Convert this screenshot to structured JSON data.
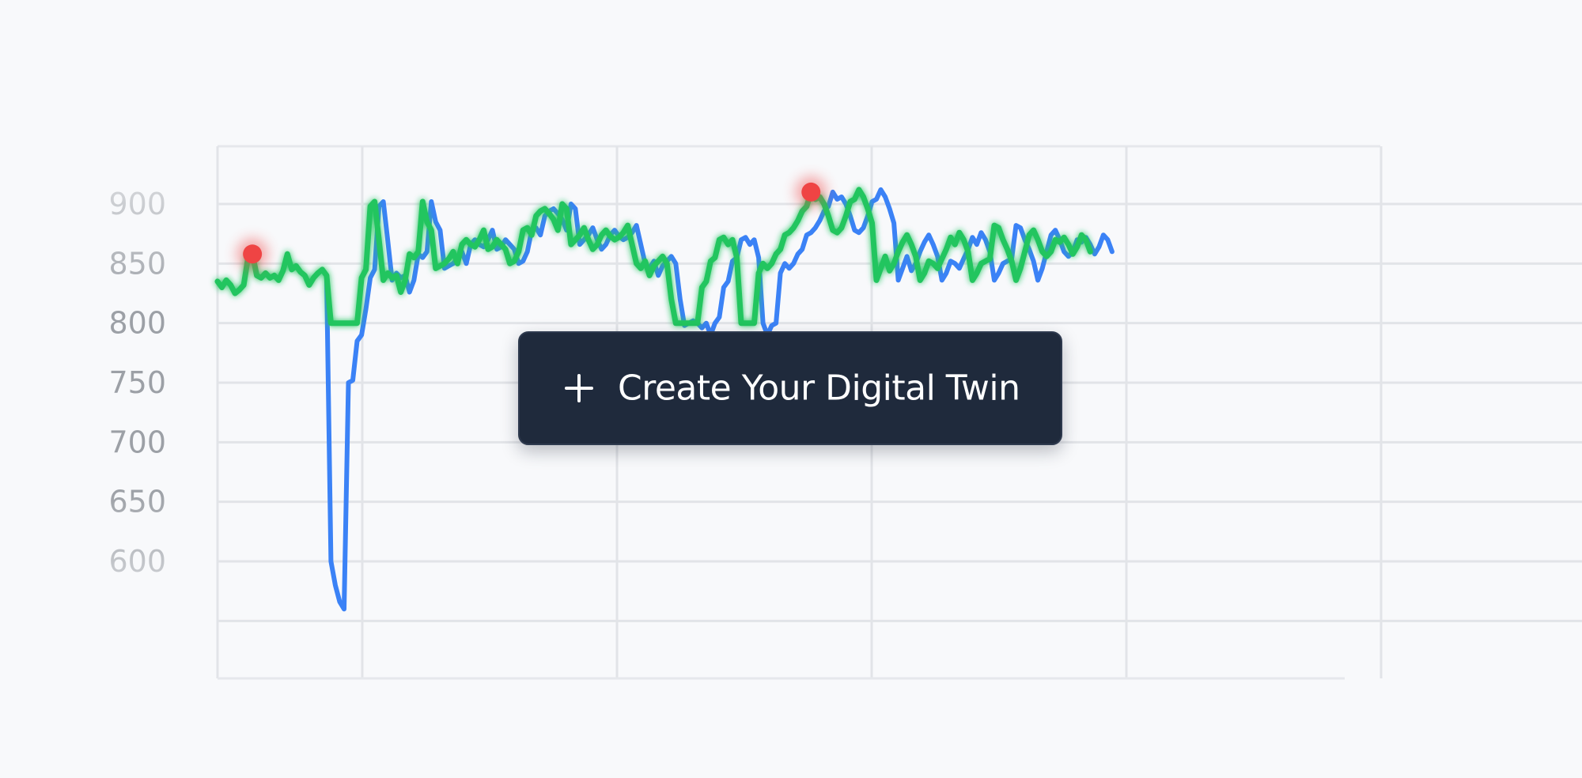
{
  "chart_data": {
    "type": "line",
    "y_ticks": [
      "900",
      "850",
      "800",
      "750",
      "700",
      "650",
      "600"
    ],
    "ylim": [
      550,
      950
    ],
    "grid": true,
    "x": [
      0,
      1,
      2,
      3,
      4,
      5,
      6,
      7,
      8,
      9,
      10,
      11,
      12,
      13,
      14,
      15,
      16,
      17,
      18,
      19,
      20,
      21,
      22,
      23,
      24,
      25,
      26,
      27,
      28,
      29,
      30,
      31,
      32,
      33,
      34,
      35,
      36,
      37,
      38,
      39,
      40,
      41,
      42,
      43,
      44,
      45,
      46,
      47,
      48,
      49,
      50,
      51,
      52,
      53,
      54,
      55,
      56,
      57,
      58,
      59,
      60,
      61,
      62,
      63,
      64,
      65,
      66,
      67,
      68,
      69,
      70,
      71,
      72,
      73,
      74,
      75,
      76,
      77,
      78,
      79,
      80,
      81,
      82,
      83,
      84,
      85,
      86,
      87,
      88,
      89,
      90,
      91,
      92,
      93,
      94,
      95,
      96,
      97,
      98,
      99,
      100,
      101,
      102,
      103,
      104,
      105,
      106,
      107,
      108,
      109,
      110,
      111,
      112,
      113,
      114,
      115,
      116,
      117,
      118,
      119,
      120,
      121,
      122,
      123,
      124,
      125,
      126,
      127,
      128,
      129,
      130,
      131,
      132,
      133,
      134,
      135,
      136,
      137,
      138,
      139,
      140,
      141,
      142,
      143,
      144,
      145,
      146,
      147,
      148,
      149,
      150,
      151,
      152,
      153,
      154,
      155,
      156,
      157,
      158,
      159,
      160,
      161,
      162,
      163,
      164,
      165,
      166,
      167,
      168,
      169,
      170,
      171,
      172,
      173,
      174,
      175,
      176,
      177,
      178,
      179,
      180,
      181,
      182,
      183,
      184,
      185,
      186,
      187,
      188,
      189,
      190,
      191,
      192,
      193,
      194,
      195,
      196,
      197,
      198,
      199,
      200,
      201,
      202,
      203,
      204,
      205,
      206,
      207,
      208,
      209,
      210,
      211,
      212,
      213,
      214,
      215,
      216,
      217,
      218,
      219,
      220,
      221,
      222,
      223,
      224,
      225,
      226,
      227,
      228,
      229,
      230,
      231,
      232,
      233,
      234,
      235,
      236,
      237,
      238,
      239,
      240,
      241,
      242,
      243,
      244,
      245,
      246,
      247,
      248,
      249,
      250,
      251,
      252,
      253,
      254,
      255,
      256,
      257,
      258,
      259,
      260,
      261,
      262,
      263,
      264,
      265,
      266,
      267,
      268,
      269,
      270,
      271,
      272,
      273,
      274,
      275,
      276,
      277,
      278,
      279,
      280,
      281,
      282,
      283,
      284,
      285,
      286,
      287,
      288,
      289,
      290,
      291,
      292,
      293,
      294,
      295,
      296,
      297,
      298,
      299,
      300
    ],
    "series": [
      {
        "color": "#3b82f6",
        "values": [
          835,
          830,
          836,
          832,
          825,
          828,
          832,
          855,
          858,
          840,
          838,
          842,
          838,
          840,
          836,
          844,
          858,
          845,
          848,
          843,
          840,
          832,
          838,
          842,
          845,
          840,
          600,
          580,
          566,
          560,
          750,
          752,
          785,
          790,
          812,
          838,
          845,
          898,
          902,
          870,
          836,
          842,
          838,
          840,
          826,
          836,
          858,
          855,
          860,
          902,
          885,
          878,
          846,
          848,
          850,
          854,
          860,
          850,
          866,
          870,
          866,
          864,
          870,
          878,
          862,
          864,
          870,
          866,
          862,
          850,
          852,
          860,
          878,
          880,
          874,
          890,
          894,
          896,
          892,
          887,
          878,
          900,
          896,
          866,
          870,
          874,
          880,
          870,
          862,
          866,
          874,
          878,
          873,
          870,
          872,
          876,
          882,
          866,
          850,
          846,
          852,
          840,
          848,
          852,
          856,
          850,
          820,
          798,
          800,
          802,
          800,
          796,
          800,
          790,
          800,
          805,
          830,
          835,
          852,
          855,
          870,
          872,
          866,
          870,
          855,
          800,
          790,
          798,
          800,
          842,
          850,
          846,
          850,
          858,
          862,
          874,
          876,
          880,
          886,
          894,
          898,
          910,
          904,
          906,
          900,
          890,
          878,
          876,
          880,
          890,
          902,
          904,
          912,
          906,
          896,
          884,
          836,
          846,
          856,
          844,
          850,
          860,
          868,
          874,
          866,
          856,
          836,
          842,
          852,
          850,
          846,
          854,
          862,
          872,
          866,
          876,
          870,
          860,
          836,
          842,
          850,
          852,
          854,
          882,
          880,
          870,
          862,
          852,
          836,
          846,
          860,
          874,
          878,
          870,
          860,
          856,
          860,
          870,
          868,
          872,
          866,
          858,
          864,
          874,
          870,
          860
        ],
        "note_visible": "partially hidden behind button"
      },
      {
        "color": "#22c55e",
        "values": [
          835,
          830,
          836,
          832,
          825,
          828,
          832,
          855,
          858,
          840,
          838,
          842,
          838,
          840,
          836,
          844,
          858,
          845,
          848,
          843,
          840,
          832,
          838,
          842,
          845,
          840,
          800,
          800,
          800,
          800,
          800,
          800,
          800,
          838,
          845,
          898,
          902,
          870,
          836,
          842,
          838,
          840,
          826,
          836,
          858,
          855,
          860,
          902,
          885,
          878,
          846,
          848,
          850,
          854,
          860,
          850,
          866,
          870,
          866,
          864,
          870,
          878,
          862,
          864,
          870,
          866,
          862,
          850,
          852,
          860,
          878,
          880,
          874,
          890,
          894,
          896,
          892,
          887,
          878,
          900,
          896,
          866,
          870,
          874,
          880,
          870,
          862,
          866,
          874,
          878,
          873,
          870,
          872,
          876,
          882,
          866,
          850,
          846,
          852,
          840,
          848,
          852,
          856,
          850,
          820,
          800,
          800,
          800,
          800,
          800,
          800,
          830,
          835,
          852,
          855,
          870,
          872,
          866,
          870,
          855,
          800,
          800,
          800,
          800,
          842,
          850,
          846,
          850,
          858,
          862,
          874,
          876,
          880,
          886,
          894,
          898,
          910,
          904,
          906,
          900,
          890,
          878,
          876,
          880,
          890,
          902,
          904,
          912,
          906,
          896,
          884,
          836,
          846,
          856,
          844,
          850,
          860,
          868,
          874,
          866,
          856,
          836,
          842,
          852,
          850,
          846,
          854,
          862,
          872,
          866,
          876,
          870,
          860,
          836,
          842,
          850,
          852,
          854,
          882,
          880,
          870,
          862,
          852,
          836,
          846,
          860,
          874,
          878,
          870,
          860,
          856,
          860,
          870,
          868,
          872,
          866,
          858,
          864,
          874,
          870,
          860
        ]
      }
    ],
    "anomalies": [
      {
        "x": 8,
        "y": 858,
        "color": "#ef4444"
      },
      {
        "x": 136,
        "y": 910,
        "color": "#ef4444"
      }
    ]
  },
  "cta": {
    "label": "Create Your Digital Twin",
    "icon": "plus-icon"
  }
}
